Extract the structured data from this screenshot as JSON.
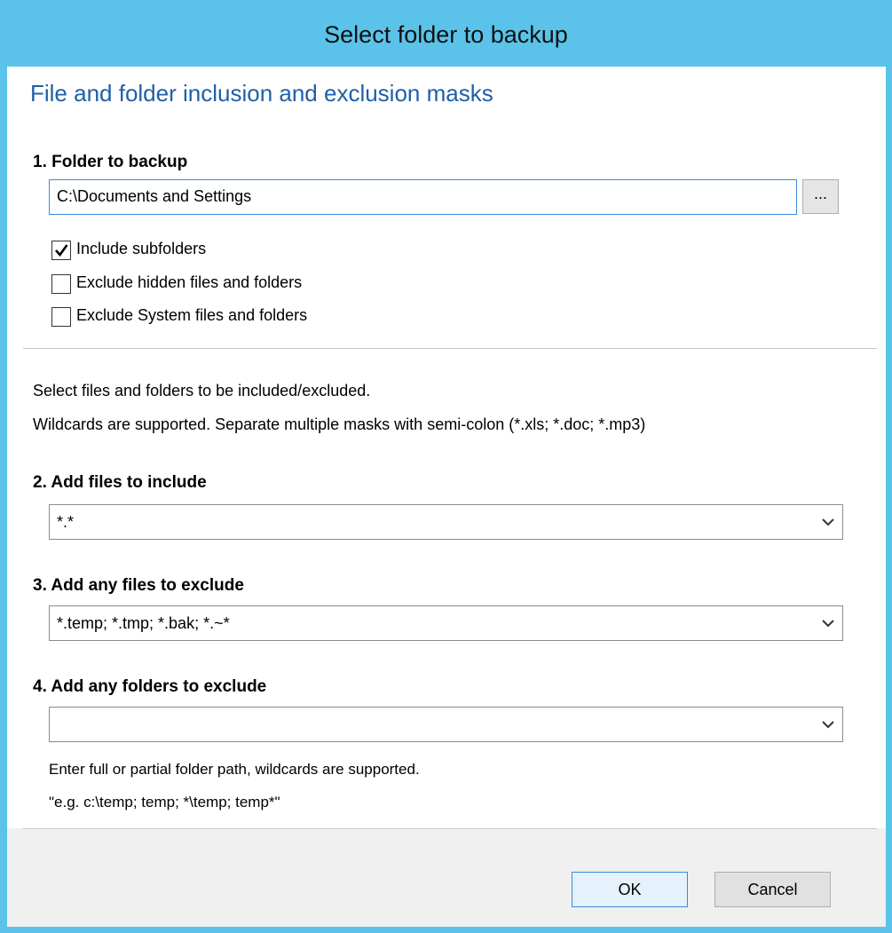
{
  "window": {
    "title": "Select folder to backup"
  },
  "header": {
    "subtitle": "File and folder inclusion and exclusion masks"
  },
  "folder": {
    "label": "1. Folder to backup",
    "path": "C:\\Documents and Settings",
    "browse_label": "..."
  },
  "options": {
    "include_subfolders": {
      "label": "Include subfolders",
      "checked": true
    },
    "exclude_hidden": {
      "label": "Exclude hidden files and folders",
      "checked": false
    },
    "exclude_system": {
      "label": "Exclude System files and folders",
      "checked": false
    }
  },
  "instructions": {
    "line1": "Select files and folders to be included/excluded.",
    "line2": "Wildcards are supported. Separate multiple masks with semi-colon (*.xls; *.doc; *.mp3)"
  },
  "include_files": {
    "label": "2. Add files to include",
    "value": "*.*"
  },
  "exclude_files": {
    "label": "3. Add any files to exclude",
    "value": "*.temp; *.tmp; *.bak; *.~*"
  },
  "exclude_folders": {
    "label": "4. Add any folders to exclude",
    "value": "",
    "hint1": "Enter full or partial folder path, wildcards are supported.",
    "hint2": "\"e.g.  c:\\temp; temp; *\\temp; temp*\""
  },
  "buttons": {
    "ok": "OK",
    "cancel": "Cancel"
  },
  "colors": {
    "titlebar": "#5bc3e9",
    "subtitle": "#1f5fa8",
    "focus_border": "#3c8ad8"
  }
}
